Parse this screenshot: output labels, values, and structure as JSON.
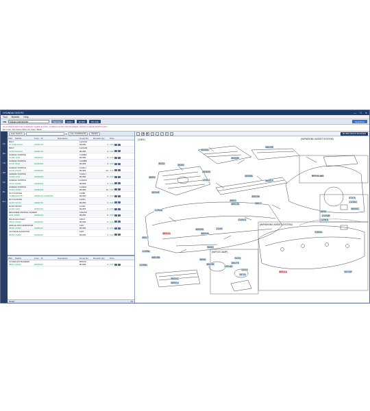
{
  "window": {
    "title": "HYUNDAI GDS PC",
    "controls": [
      "—",
      "☐",
      "✕"
    ]
  },
  "menu": [
    "Tool",
    "Bulletin",
    "Help"
  ],
  "vin_bar": {
    "label": "VIN",
    "vin_value": "KMHEC41BXBA555",
    "model": "Car Yes",
    "chips": [
      "ROH1",
      "2P.IRS",
      "PG 3.5b"
    ],
    "right_button": "SparePlus"
  },
  "info": {
    "line1": "IS HYUNDAI MOTOR COMPANY SAMPLE DATA, SAMPLE NOTE FOR BUMPER, FRONT & REAR PARTS INFO",
    "line2": "Ext Color: 9H Ocean Silver Int Color: Black"
  },
  "sidebar": [
    "PC",
    "MA",
    "TD",
    "EN",
    "SC",
    "BL",
    "ALL"
  ],
  "search": {
    "mode": "Auto Search",
    "placeholder": "",
    "dropdown": "ALL COMPLETE",
    "action": "RESET"
  },
  "columns": [
    "PNC",
    "PartNo",
    "From - To",
    "Description",
    "Group No",
    "Remarks",
    "Qty",
    "Price"
  ],
  "parts": [
    {
      "name": "BOLT",
      "pnc": "",
      "partno": "97713B 3K010",
      "from": "20090701",
      "group": "112OAD",
      "grp2": "86-865",
      "qty": "1",
      "price": "0.00"
    },
    {
      "name": "BOLT",
      "pnc": "",
      "partno": "1125A 9LG010",
      "from": "20090701",
      "group": "112OAB",
      "grp2": "86-865",
      "qty": "4",
      "price": "0.00"
    },
    {
      "name": "SCREW-TAPPING",
      "pnc": "",
      "partno": "12439 1K01",
      "from": "20090327",
      "group": "1249BC",
      "grp2": "86-865",
      "qty": "3",
      "price": "0.00"
    },
    {
      "name": "SCREW-TAPPING",
      "pnc": "",
      "partno": "12441 0K10",
      "from": "20090923",
      "group": "1249BB",
      "grp2": "86-865",
      "qty": "4",
      "price": "0.00"
    },
    {
      "name": "SCREW-TAPPING",
      "pnc": "",
      "partno": "12443 0K108",
      "from": "20090923",
      "group": "1249LJ",
      "grp2": "86-865",
      "qty": "14",
      "price": "0.00"
    },
    {
      "name": "SCREW-TAPPING",
      "pnc": "",
      "partno": "12443 1K10",
      "from": "20090923",
      "group": "1249LJ",
      "grp2": "86-865",
      "qty": "6",
      "price": "0.00"
    },
    {
      "name": "SCREW-TAPPING",
      "pnc": "",
      "partno": "12441 0K203",
      "from": "20090923",
      "group": "1249NC",
      "grp2": "86-865",
      "qty": "1",
      "price": "0.00"
    },
    {
      "name": "SCREW-TAPPING",
      "pnc": "",
      "partno": "12463 0K201",
      "from": "20090923",
      "group": "1249NL",
      "grp2": "86-865",
      "qty": "11",
      "price": "0.00"
    },
    {
      "name": "NUT-FLANGE",
      "pnc": "",
      "partno": "1138B 06107B",
      "from": "20090701-20180701",
      "group": "11386",
      "grp2": "86-865",
      "qty": "1",
      "price": "0.00"
    },
    {
      "name": "NUT-FLANGE",
      "pnc": "",
      "partno": "1246Y 0K101",
      "from": "20090701",
      "group": "1129C",
      "grp2": "86-865",
      "qty": "1",
      "price": "0.00"
    },
    {
      "name": "RIVET-BLIND",
      "pnc": "",
      "partno": "14160 4H01",
      "from": "20091119",
      "group": "14160",
      "grp2": "86-865",
      "qty": "2",
      "price": "0.00"
    },
    {
      "name": "RETAINER-TAPPING SCREW",
      "pnc": "",
      "partno": "1491 40300",
      "from": "20090623",
      "group": "1491AD",
      "grp2": "86-865",
      "qty": "6",
      "price": "0.00"
    },
    {
      "name": "BULB-HALOGEN",
      "pnc": "",
      "partno": "18647 21000",
      "from": "20090327",
      "group": "18647",
      "grp2": "86-865",
      "qty": "2",
      "price": "0.00"
    },
    {
      "name": "GRILLE ASSY-RADIATOR",
      "pnc": "",
      "partno": "86350 2S000",
      "from": "20090327",
      "group": "1267",
      "grp2": "86-865",
      "qty": "1",
      "price": "0.00"
    },
    {
      "name": "CR PIECE-RADIATOR",
      "pnc": "",
      "partno": "86353 2S000",
      "from": "20090327",
      "group": "1267",
      "grp2": "86-865",
      "qty": "1",
      "price": "0.00"
    }
  ],
  "lower_parts": [
    {
      "name": "COVER-F/R BUMPER",
      "pnc": "",
      "partno": "86511 2S000",
      "from": "20090327",
      "group": "86511A",
      "grp2": "86-865",
      "qty": "1",
      "price": "0.00"
    }
  ],
  "status": {
    "text": "Ready",
    "count": "15"
  },
  "diagram": {
    "mode_button": "86-865 FRONT BUMPER",
    "toolbar": [
      "⌂",
      "◀",
      "▶",
      "+",
      "−",
      "⤢",
      "⎙",
      "🔍"
    ],
    "section_labels": [
      {
        "text": "(W/PARKING ASSIST SYSTEM)",
        "key": "s1"
      },
      {
        "text": "(W/PARKING ASSIST SYSTEM)",
        "key": "s2"
      },
      {
        "text": "(W/FOG LAMP)",
        "key": "s3"
      },
      {
        "text": "(12MY)",
        "key": "s4"
      }
    ],
    "ref_label": "REF.60-660",
    "callouts": [
      {
        "id": "c1",
        "text": "86355C"
      },
      {
        "id": "c2",
        "text": "86520B"
      },
      {
        "id": "c3",
        "text": "86355B"
      },
      {
        "id": "c4",
        "text": "86350"
      },
      {
        "id": "c5",
        "text": "86352"
      },
      {
        "id": "c6",
        "text": "86353D"
      },
      {
        "id": "c7",
        "text": "86590"
      },
      {
        "id": "c8",
        "text": "86355A"
      },
      {
        "id": "c9",
        "text": "86551A"
      },
      {
        "id": "c10",
        "text": "86520B"
      },
      {
        "id": "c11",
        "text": "86520"
      },
      {
        "id": "c12",
        "text": "1249LJ"
      },
      {
        "id": "c13",
        "text": "86354E"
      },
      {
        "id": "c14",
        "text": "86512D"
      },
      {
        "id": "c15",
        "text": "86512"
      },
      {
        "id": "c16",
        "text": "1249LD"
      },
      {
        "id": "c17",
        "text": "86511A"
      },
      {
        "id": "c18",
        "text": "86517"
      },
      {
        "id": "c19",
        "text": "86550D"
      },
      {
        "id": "c20",
        "text": "86554A"
      },
      {
        "id": "c21",
        "text": "14160"
      },
      {
        "id": "c22",
        "text": "1249NL"
      },
      {
        "id": "c23",
        "text": "86560"
      },
      {
        "id": "c24",
        "text": "86518M"
      },
      {
        "id": "c25",
        "text": "86581"
      },
      {
        "id": "c26",
        "text": "86525E"
      },
      {
        "id": "c27",
        "text": "1491AD"
      },
      {
        "id": "c28",
        "text": "92201"
      },
      {
        "id": "c29",
        "text": "18647B"
      },
      {
        "id": "c30",
        "text": "92202"
      },
      {
        "id": "c31",
        "text": "86590C"
      },
      {
        "id": "c32",
        "text": "86591A"
      },
      {
        "id": "c33",
        "text": "95700"
      },
      {
        "id": "c34",
        "text": "86551"
      },
      {
        "id": "c35",
        "text": "1249QB"
      },
      {
        "id": "c36",
        "text": "1125KD"
      },
      {
        "id": "c37",
        "text": "87376"
      },
      {
        "id": "c38",
        "text": "1125AC"
      },
      {
        "id": "c39",
        "text": "86590C"
      },
      {
        "id": "c40",
        "text": "91800L"
      },
      {
        "id": "c41",
        "text": "86511A"
      },
      {
        "id": "c42",
        "text": "95700P"
      },
      {
        "id": "c43",
        "text": "1125AD"
      },
      {
        "id": "c44",
        "text": "1249NL"
      }
    ]
  }
}
